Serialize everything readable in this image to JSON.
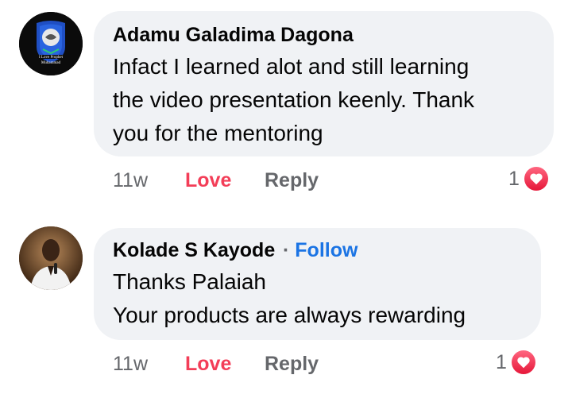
{
  "comments": [
    {
      "author": "Adamu Galadima Dagona",
      "avatar_text_line1": "I Love Prophet",
      "avatar_text_line2": "Muhammad",
      "lines": [
        "Infact I learned alot and still learning",
        "the video presentation keenly. Thank",
        "you for the mentoring"
      ],
      "time": "11w",
      "love_label": "Love",
      "reply_label": "Reply",
      "reaction_count": "1",
      "reaction_icon": "heart-icon"
    },
    {
      "author": "Kolade S Kayode",
      "separator": "·",
      "follow_label": "Follow",
      "lines": [
        "Thanks Palaiah",
        "Your products are always rewarding"
      ],
      "time": "11w",
      "love_label": "Love",
      "reply_label": "Reply",
      "reaction_count": "1",
      "reaction_icon": "heart-icon"
    }
  ],
  "colors": {
    "bubble": "#f0f2f5",
    "love": "#f33e58",
    "follow": "#1b74e4",
    "meta": "#65676b"
  }
}
